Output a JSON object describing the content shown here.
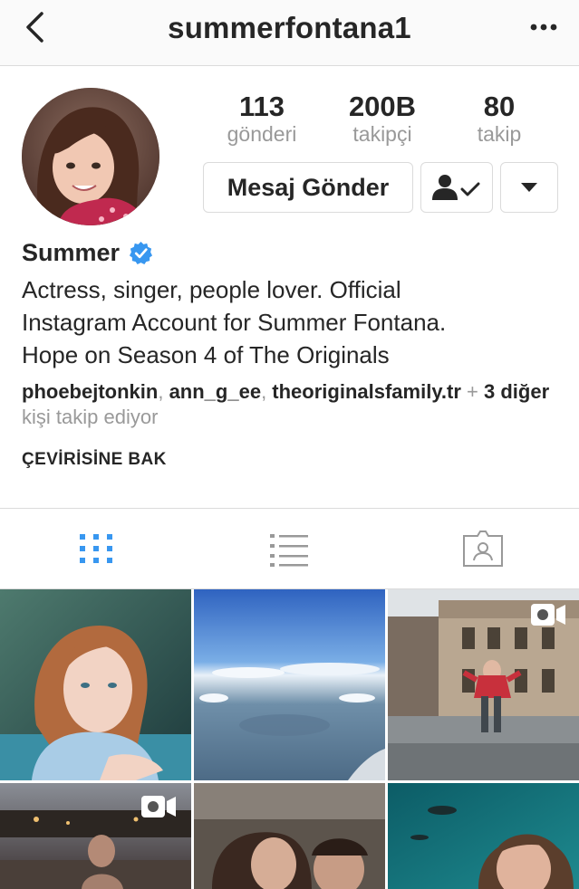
{
  "header": {
    "username": "summerfontana1",
    "back_icon": "chevron-left-icon",
    "more_icon": "more-horizontal-icon"
  },
  "stats": {
    "posts": {
      "value": "113",
      "label": "gönderi"
    },
    "followers": {
      "value": "200B",
      "label": "takipçi"
    },
    "following": {
      "value": "80",
      "label": "takip"
    }
  },
  "actions": {
    "message_label": "Mesaj Gönder",
    "following_icon": "person-check-icon",
    "dropdown_icon": "caret-down-icon"
  },
  "profile": {
    "name": "Summer",
    "verified": true,
    "bio_lines": [
      "Actress, singer, people lover. Official",
      "Instagram Account for Summer Fontana.",
      "Hope on Season 4 of The Originals"
    ],
    "followed_by": {
      "user1": "phoebejtonkin",
      "sep1": ", ",
      "user2": "ann_g_ee",
      "sep2": ", ",
      "user3": "theoriginalsfamily.tr",
      "plus": " + ",
      "others": "3 diğer",
      "suffix": " kişi takip ediyor"
    },
    "translate_label": "ÇEVİRİSİNE BAK"
  },
  "tabs": {
    "active": "grid",
    "items": [
      "grid-icon",
      "list-icon",
      "tagged-icon"
    ]
  },
  "colors": {
    "accent": "#3897f0",
    "text": "#262626",
    "muted": "#999999",
    "border": "#dbdbdb"
  },
  "grid": {
    "photos": [
      {
        "subject": "girl leaning on rail",
        "video": false
      },
      {
        "subject": "sky view from airplane",
        "video": false
      },
      {
        "subject": "girl in front of building",
        "video": true
      },
      {
        "subject": "girl at dusk on balcony",
        "video": true
      },
      {
        "subject": "selfie",
        "video": false
      },
      {
        "subject": "underwater aquarium selfie",
        "video": false
      }
    ]
  }
}
